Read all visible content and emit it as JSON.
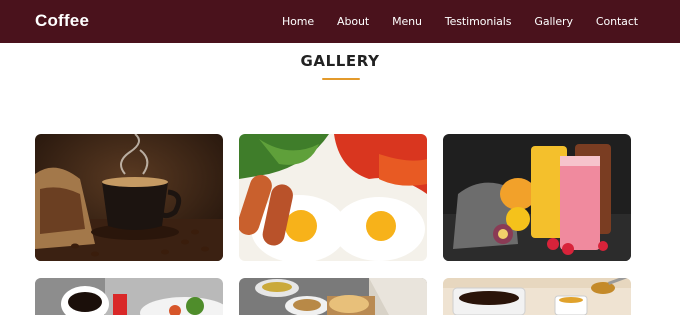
{
  "brand": {
    "name": "Coffee"
  },
  "nav": {
    "items": [
      {
        "label": "Home"
      },
      {
        "label": "About"
      },
      {
        "label": "Menu"
      },
      {
        "label": "Testimonials"
      },
      {
        "label": "Gallery"
      },
      {
        "label": "Contact"
      }
    ]
  },
  "gallery": {
    "title": "GALLERY",
    "accent_color": "#e39a2b",
    "images": [
      {
        "subject": "coffee-cup-with-beans"
      },
      {
        "subject": "fried-eggs-sausages-breakfast"
      },
      {
        "subject": "fruit-smoothies"
      },
      {
        "subject": "coffee-with-plate"
      },
      {
        "subject": "breakfast-spread"
      },
      {
        "subject": "coffee-with-honey"
      }
    ]
  },
  "colors": {
    "navbar": "#4a121c",
    "text": "#222222"
  }
}
